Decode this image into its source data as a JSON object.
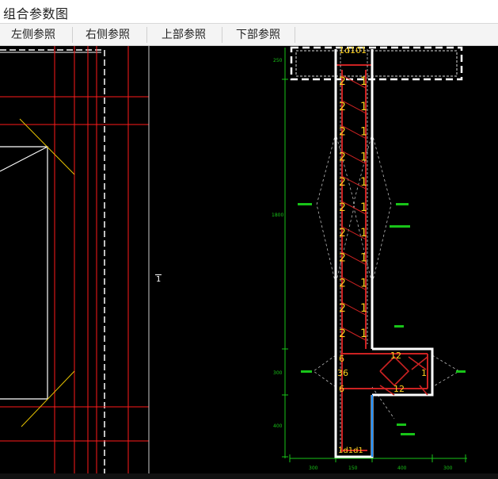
{
  "window": {
    "title": "组合参数图"
  },
  "toolbar": {
    "tabs": [
      {
        "label": "左侧参照"
      },
      {
        "label": "右侧参照"
      },
      {
        "label": "上部参照"
      },
      {
        "label": "下部参照"
      }
    ]
  },
  "drawing": {
    "sheet_marker": "1",
    "top_cell_label": "1d101",
    "bottom_cell_label": "1d1d1",
    "bar_rows": [
      {
        "left": "2",
        "right": "1"
      },
      {
        "left": "2",
        "right": "1"
      },
      {
        "left": "2",
        "right": "1"
      },
      {
        "left": "2",
        "right": "1"
      },
      {
        "left": "2",
        "right": "1"
      },
      {
        "left": "2",
        "right": "1"
      },
      {
        "left": "2",
        "right": "1"
      },
      {
        "left": "2",
        "right": "1"
      },
      {
        "left": "2",
        "right": "1"
      },
      {
        "left": "2",
        "right": "1"
      },
      {
        "left": "2",
        "right": "1"
      }
    ],
    "flange_labels": {
      "top_right": "12",
      "side": "1",
      "mid": "12"
    },
    "web_lower_labels": [
      "6",
      "36",
      "6"
    ],
    "dimension_labels": {
      "left_vertical": [
        "250",
        "1800",
        "300",
        "400"
      ],
      "bottom": [
        "300",
        "150",
        "400",
        "300"
      ]
    },
    "colors": {
      "background": "#000000",
      "grid": "#ff1a1a",
      "outline": "#ffffff",
      "bar_text": "#ffd21f",
      "bars": "#cc2222",
      "dimension": "#18c418",
      "accent": "#1e90ff"
    }
  }
}
